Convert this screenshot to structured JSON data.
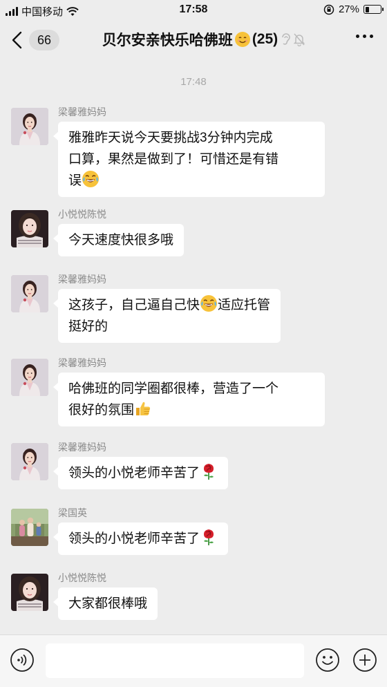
{
  "status_bar": {
    "carrier": "中国移动",
    "time": "17:58",
    "battery_text": "27%",
    "battery_level": 0.27
  },
  "header": {
    "back_count": "66",
    "title": "贝尔安亲快乐哈佛班",
    "member_count": "(25)"
  },
  "time_divider": "17:48",
  "messages": [
    {
      "sender": "梁馨雅妈妈",
      "lines": [
        "雅雅昨天说今天要挑战3分钟内完成",
        "口算，果然是做到了！可惜还是有错",
        "误"
      ],
      "emoji": "laugh-cry-emoji"
    },
    {
      "sender": "小悦悦陈悦",
      "lines": [
        "今天速度快很多哦"
      ]
    },
    {
      "sender": "梁馨雅妈妈",
      "lines": [
        "这孩子，自己逼自己快",
        "挺好的"
      ],
      "line1_tail": "适应托管",
      "emoji": "laugh-cry-emoji"
    },
    {
      "sender": "梁馨雅妈妈",
      "lines": [
        "哈佛班的同学圈都很棒，营造了一个",
        "很好的氛围"
      ],
      "emoji": "thumbs-up-emoji"
    },
    {
      "sender": "梁馨雅妈妈",
      "lines": [
        "领头的小悦老师辛苦了"
      ],
      "emoji": "rose-emoji"
    },
    {
      "sender": "梁国英",
      "lines": [
        "领头的小悦老师辛苦了"
      ],
      "emoji": "rose-emoji"
    },
    {
      "sender": "小悦悦陈悦",
      "lines": [
        "大家都很棒哦"
      ]
    }
  ],
  "input_bar": {
    "icons": [
      "voice-icon",
      "emoji-icon",
      "plus-icon"
    ],
    "input_value": ""
  }
}
